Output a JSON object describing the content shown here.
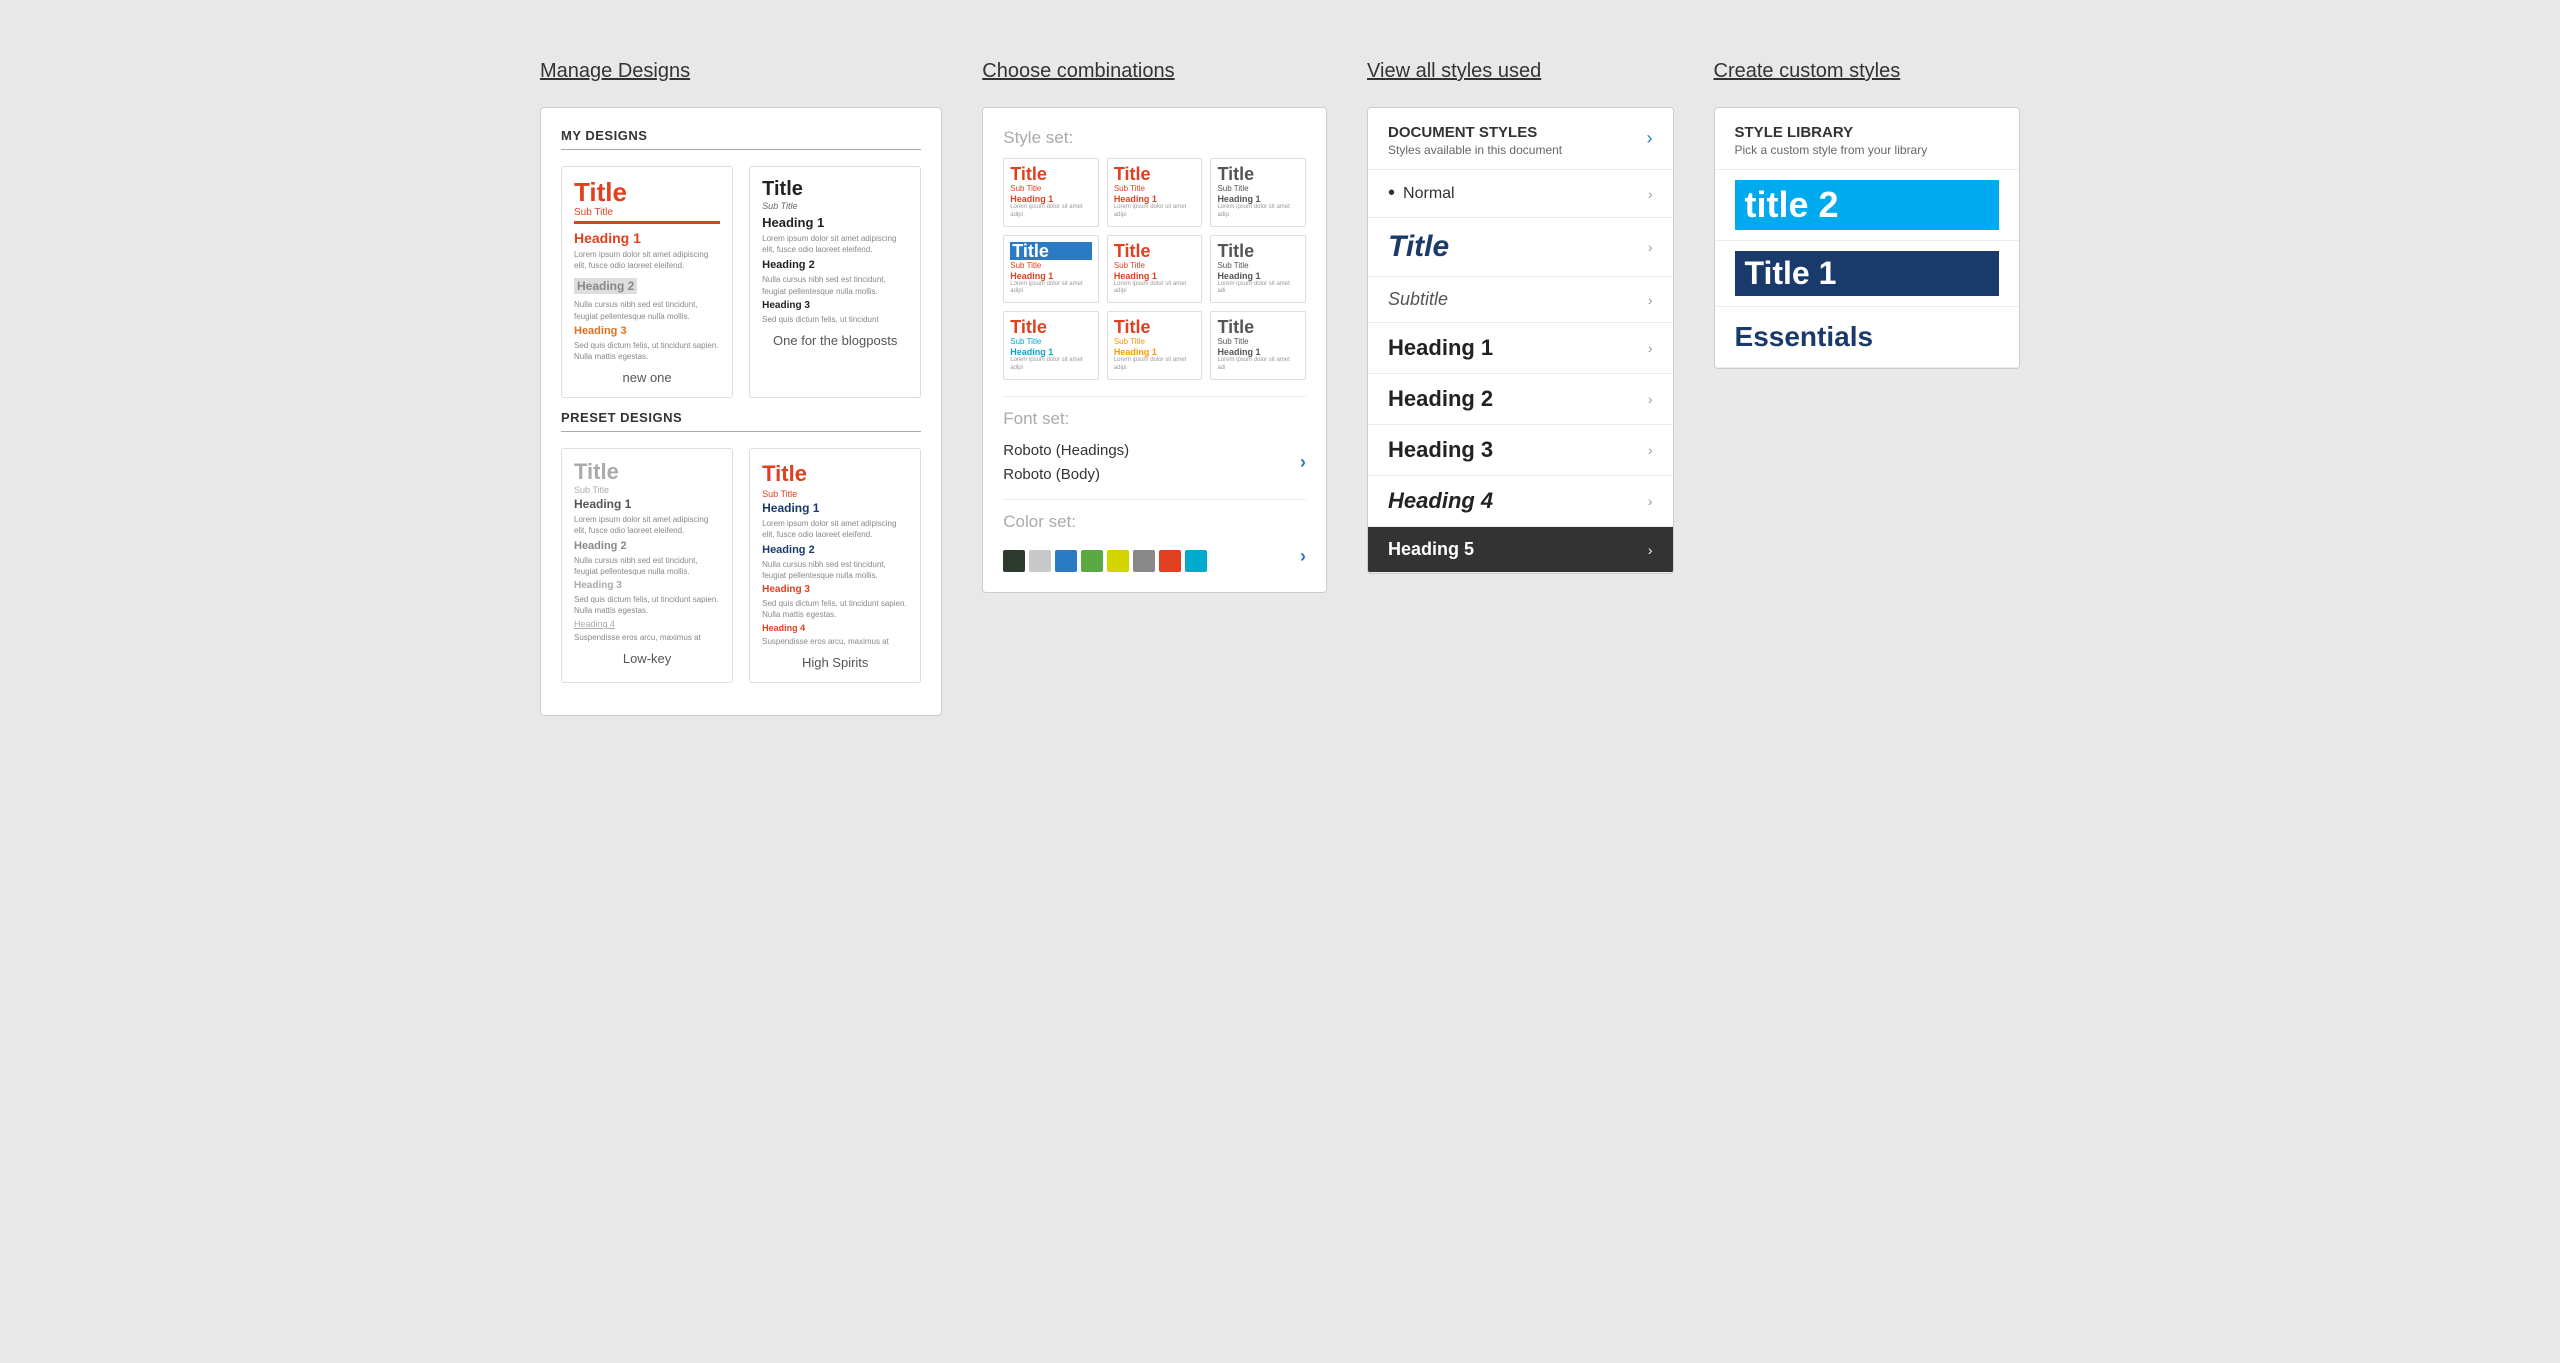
{
  "columns": {
    "col1": {
      "title": "Manage Designs",
      "myDesigns": {
        "label": "MY DESIGNS",
        "cards": [
          {
            "name": "new one",
            "theme": "red"
          },
          {
            "name": "One for the blogposts",
            "theme": "black"
          }
        ]
      },
      "presetDesigns": {
        "label": "PRESET DESIGNS",
        "cards": [
          {
            "name": "Low-key",
            "theme": "lowkey"
          },
          {
            "name": "High Spirits",
            "theme": "highspirits"
          }
        ]
      }
    },
    "col2": {
      "title": "Choose combinations",
      "styleSet": {
        "label": "Style set:"
      },
      "fontSet": {
        "label": "Font set:",
        "fonts": [
          "Roboto (Headings)",
          "Roboto (Body)"
        ]
      },
      "colorSet": {
        "label": "Color set:"
      },
      "colors": [
        "#2d3a2e",
        "#c8c8c8",
        "#2a7ac4",
        "#5aaa44",
        "#d4d400",
        "#888",
        "#e04020",
        "#00aacc"
      ]
    },
    "col3": {
      "title": "View all styles used",
      "panel": {
        "heading": "DOCUMENT STYLES",
        "subheading": "Styles available in this document",
        "items": [
          {
            "label": "Normal",
            "style": "normal"
          },
          {
            "label": "Title",
            "style": "title"
          },
          {
            "label": "Subtitle",
            "style": "subtitle"
          },
          {
            "label": "Heading 1",
            "style": "h1"
          },
          {
            "label": "Heading 2",
            "style": "h2"
          },
          {
            "label": "Heading 3",
            "style": "h3"
          },
          {
            "label": "Heading 4",
            "style": "h4"
          },
          {
            "label": "Heading 5",
            "style": "h5",
            "active": true
          }
        ]
      }
    },
    "col4": {
      "title": "Create custom styles",
      "panel": {
        "heading": "STYLE LIBRARY",
        "subheading": "Pick a custom style from your library",
        "items": [
          {
            "label": "title 2",
            "style": "title2"
          },
          {
            "label": "Title 1",
            "style": "title1"
          },
          {
            "label": "Essentials",
            "style": "essentials"
          }
        ]
      }
    }
  }
}
